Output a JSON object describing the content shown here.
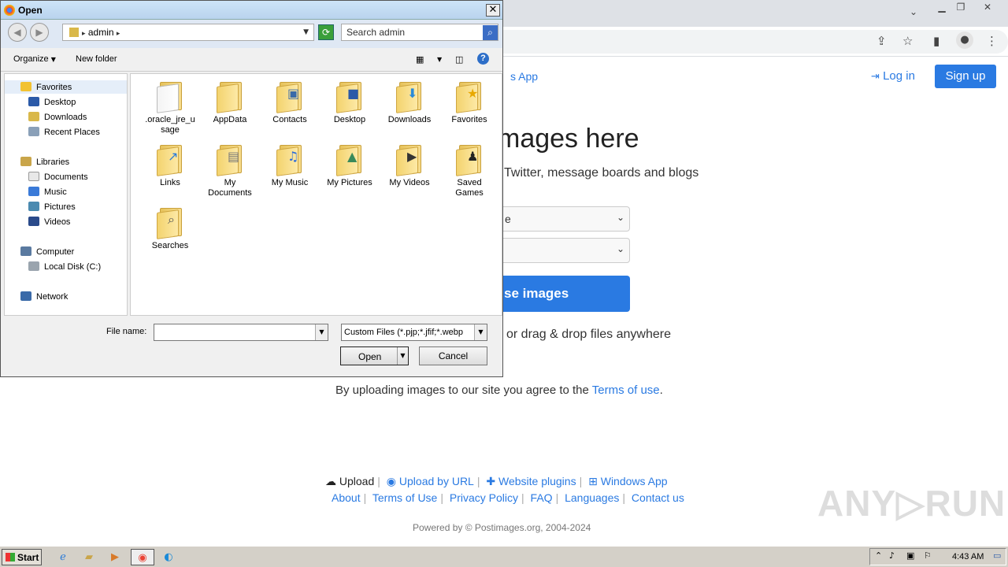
{
  "browser": {
    "app_link": "s App",
    "login": "Log in",
    "signup": "Sign up",
    "hero_title": "mages here",
    "hero_sub": "Twitter, message boards and blogs",
    "select1_value": "e",
    "select2_value": "",
    "choose_button": "se images",
    "drag_text": "or drag & drop files anywhere",
    "terms_prefix": "By uploading images to our site you agree to the ",
    "terms_link": "Terms of use",
    "terms_suffix": ".",
    "footer_row1": [
      "Upload",
      "Upload by URL",
      "Website plugins",
      "Windows App"
    ],
    "footer_row2": [
      "About",
      "Terms of Use",
      "Privacy Policy",
      "FAQ",
      "Languages",
      "Contact us"
    ],
    "powered": "Powered by © Postimages.org, 2004-2024",
    "watermark": "ANY▷RUN"
  },
  "dialog": {
    "title": "Open",
    "address": "admin",
    "search_placeholder": "Search admin",
    "organize": "Organize",
    "new_folder": "New folder",
    "nav": {
      "favorites": "Favorites",
      "desktop": "Desktop",
      "downloads": "Downloads",
      "recent": "Recent Places",
      "libraries": "Libraries",
      "documents": "Documents",
      "music": "Music",
      "pictures": "Pictures",
      "videos": "Videos",
      "computer": "Computer",
      "localdisk": "Local Disk (C:)",
      "network": "Network"
    },
    "items": [
      ".oracle_jre_usage",
      "AppData",
      "Contacts",
      "Desktop",
      "Downloads",
      "Favorites",
      "Links",
      "My Documents",
      "My Music",
      "My Pictures",
      "My Videos",
      "Saved Games",
      "Searches"
    ],
    "item_lines": [
      [
        ".oracle_jre_u",
        "sage"
      ],
      [
        "AppData"
      ],
      [
        "Contacts"
      ],
      [
        "Desktop"
      ],
      [
        "Downloads"
      ],
      [
        "Favorites"
      ],
      [
        "Links"
      ],
      [
        "My",
        "Documents"
      ],
      [
        "My Music"
      ],
      [
        "My Pictures"
      ],
      [
        "My Videos"
      ],
      [
        "Saved",
        "Games"
      ],
      [
        "Searches"
      ]
    ],
    "file_name_label": "File name:",
    "file_name_value": "",
    "file_type": "Custom Files (*.pjp;*.jfif;*.webp",
    "open_button": "Open",
    "cancel_button": "Cancel"
  },
  "taskbar": {
    "start": "Start",
    "clock": "4:43 AM"
  }
}
